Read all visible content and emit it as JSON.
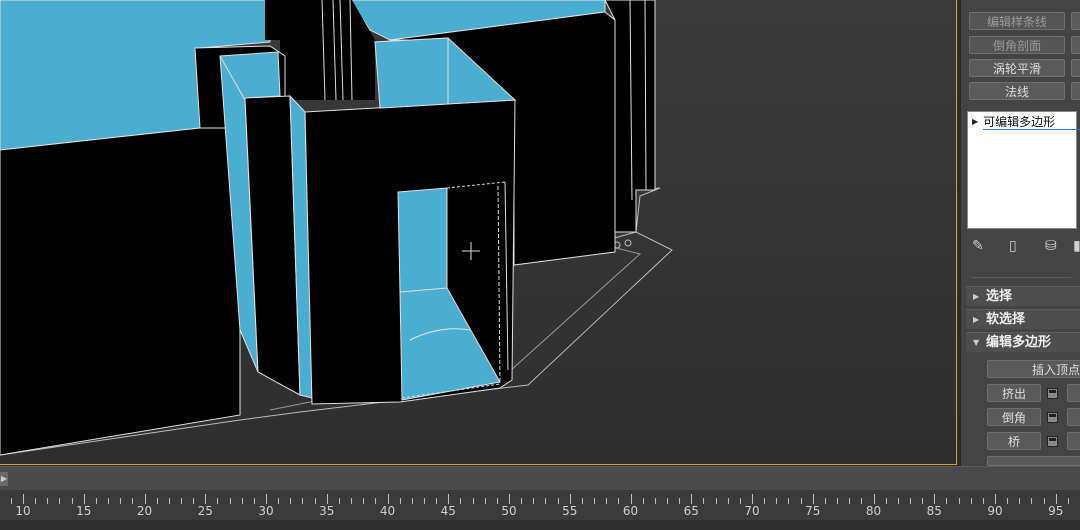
{
  "panel": {
    "buttons": {
      "edit_spline": "编辑样条线",
      "chamfer_profile": "倒角剖面",
      "turbosmooth": "涡轮平滑",
      "normal": "法线"
    },
    "modifier_stack": {
      "item": "可编辑多边形"
    },
    "rollouts": {
      "select": "选择",
      "soft_select": "软选择",
      "edit_poly": "编辑多边形"
    },
    "edit_poly_buttons": {
      "insert_vertex": "插入顶点",
      "extrude": "挤出",
      "bevel": "倒角",
      "bridge": "桥"
    },
    "stack_tool_icons": [
      "pin-icon",
      "show-end-result-icon",
      "make-unique-icon",
      "remove-modifier-icon"
    ]
  },
  "timeline": {
    "labels": [
      "10",
      "15",
      "20",
      "25",
      "30",
      "35",
      "40",
      "45",
      "50",
      "55",
      "60",
      "65",
      "70",
      "75",
      "80",
      "85",
      "90",
      "95"
    ]
  },
  "colors": {
    "accent_border": "#c9a23a",
    "mesh_face": "#4aaed0",
    "mesh_dark": "#000000"
  }
}
